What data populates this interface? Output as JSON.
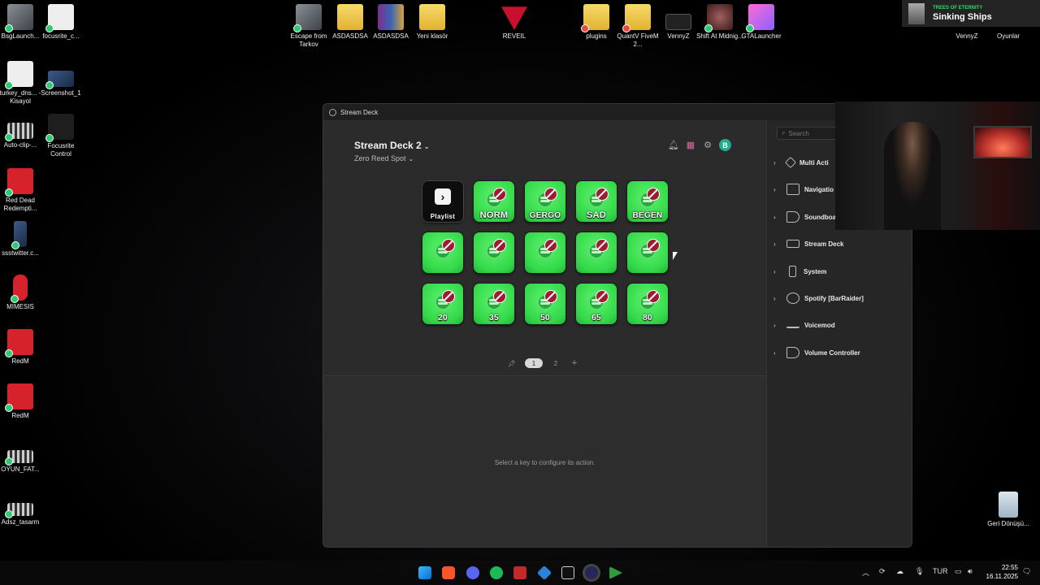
{
  "desktop": {
    "icons": [
      {
        "label": "BsgLaunch..."
      },
      {
        "label": "focusrite_c..."
      },
      {
        "label": "turkey_dns... - Kisayol"
      },
      {
        "label": "Screenshot_1"
      },
      {
        "label": "Auto-clip-..."
      },
      {
        "label": "Focusrite Control"
      },
      {
        "label": "Red Dead Redempti..."
      },
      {
        "label": "ssstwitter.c..."
      },
      {
        "label": "MIMESIS"
      },
      {
        "label": "RedM"
      },
      {
        "label": "RedM"
      },
      {
        "label": "OYUN_FAT..."
      },
      {
        "label": "Adsz_tasarm"
      },
      {
        "label": "Escape from Tarkov"
      },
      {
        "label": "ASDASDSA"
      },
      {
        "label": "ASDASDSA"
      },
      {
        "label": "Yeni klasör"
      },
      {
        "label": "REVEIL"
      },
      {
        "label": "plugins"
      },
      {
        "label": "QuantV FiveM 2..."
      },
      {
        "label": "VennyZ"
      },
      {
        "label": "Shift At Midnig..."
      },
      {
        "label": "GTALauncher"
      },
      {
        "label": "VennyZ"
      },
      {
        "label": "Oyunlar"
      },
      {
        "label": "Geri Dönüşü..."
      }
    ]
  },
  "now_playing": {
    "artist": "TREES OF ETERNITY",
    "title": "Sinking Ships"
  },
  "window": {
    "title": "Stream Deck"
  },
  "device": {
    "name": "Stream Deck 2",
    "profile": "Zero Reed Spot"
  },
  "keys": [
    {
      "label": "Playlist",
      "style": "black"
    },
    {
      "label": "NORM"
    },
    {
      "label": "GERGO"
    },
    {
      "label": "SAD"
    },
    {
      "label": "BEĞEN"
    },
    {
      "label": ""
    },
    {
      "label": ""
    },
    {
      "label": ""
    },
    {
      "label": ""
    },
    {
      "label": ""
    },
    {
      "label": "20"
    },
    {
      "label": "35"
    },
    {
      "label": "50"
    },
    {
      "label": "65"
    },
    {
      "label": "80"
    }
  ],
  "pager": {
    "pages": [
      "1",
      "2"
    ],
    "current": "1",
    "add": "+"
  },
  "config": {
    "hint": "Select a key to configure its action."
  },
  "sidebar": {
    "search_placeholder": "Search",
    "categories": [
      {
        "label": "Multi Acti"
      },
      {
        "label": "Navigatio"
      },
      {
        "label": "Soundboa"
      },
      {
        "label": "Stream Deck"
      },
      {
        "label": "System"
      },
      {
        "label": "Spotify [BarRaider]"
      },
      {
        "label": "Voicemod"
      },
      {
        "label": "Volume Controller"
      }
    ]
  },
  "taskbar": {
    "lang": "TUR",
    "time": "22:55",
    "date": "16.11.2025"
  },
  "avatar_letter": "B"
}
